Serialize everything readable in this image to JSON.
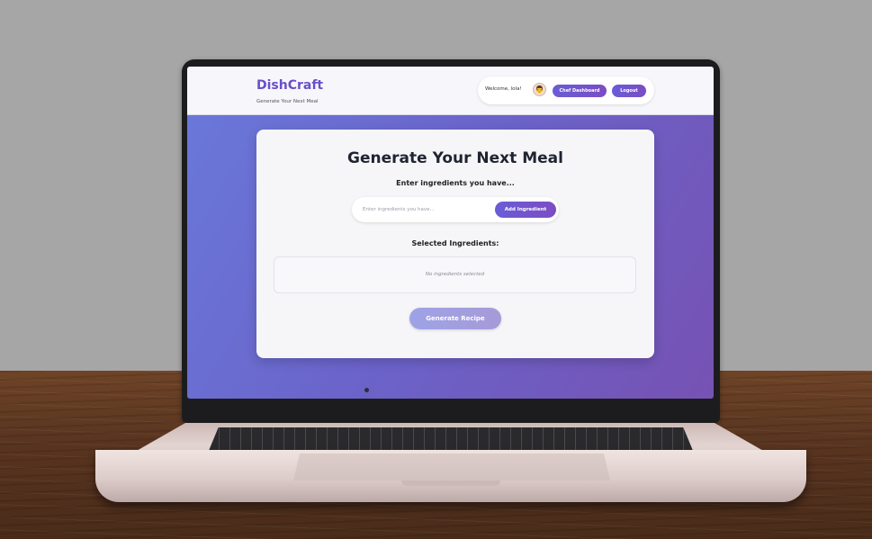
{
  "app": {
    "brand": "DishCraft",
    "tagline": "Generate Your Next Meal"
  },
  "header": {
    "welcome": "Welcome, lola!",
    "avatar_icon": "chef-avatar-icon",
    "dashboard_label": "Chef Dashboard",
    "logout_label": "Logout"
  },
  "main": {
    "title": "Generate Your Next Meal",
    "subtitle": "Enter ingredients you have...",
    "input": {
      "placeholder": "Enter ingredients you have...",
      "value": ""
    },
    "add_label": "Add Ingredient",
    "selected_title": "Selected Ingredients:",
    "empty_text": "No ingredients selected",
    "generate_label": "Generate Recipe"
  },
  "colors": {
    "accent": "#6a4fc8",
    "background_gradient_start": "#6a79db",
    "background_gradient_end": "#7652b3"
  }
}
